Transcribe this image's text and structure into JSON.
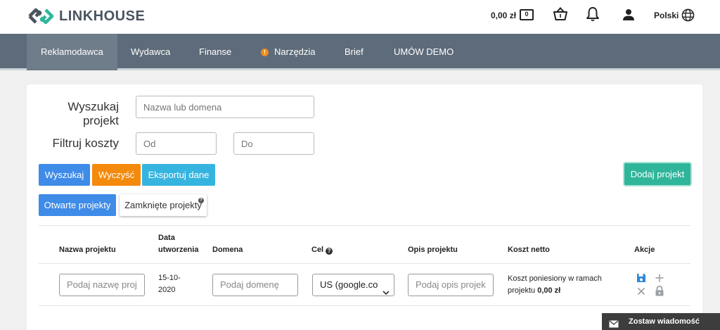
{
  "header": {
    "logo_text": "LINKHOUSE",
    "balance": "0,00 zł",
    "cash_icon_text": "0",
    "language": "Polski",
    "icons": [
      "logo-icon",
      "cash-icon",
      "basket-icon",
      "bell-icon",
      "user-icon",
      "globe-icon"
    ]
  },
  "nav": {
    "items": [
      {
        "label": "Reklamodawca",
        "active": true
      },
      {
        "label": "Wydawca",
        "active": false
      },
      {
        "label": "Finanse",
        "active": false
      },
      {
        "label": "Narzędzia",
        "active": false,
        "badge": "!"
      },
      {
        "label": "Brief",
        "active": false
      },
      {
        "label": "UMÓW DEMO",
        "active": false
      }
    ]
  },
  "filters": {
    "search_label": "Wyszukaj projekt",
    "search_placeholder": "Nazwa lub domena",
    "cost_label": "Filtruj koszty",
    "from_placeholder": "Od",
    "to_placeholder": "Do"
  },
  "actions": {
    "search": "Wyszukaj",
    "clear": "Wyczyść",
    "export": "Eksportuj dane",
    "add_project": "Dodaj projekt"
  },
  "tabs": {
    "open": "Otwarte projekty",
    "closed": "Zamknięte projekty",
    "closed_help": "?"
  },
  "table": {
    "headers": {
      "name": "Nazwa projektu",
      "date": "Data utworzenia",
      "domain": "Domena",
      "goal": "Cel",
      "description": "Opis projektu",
      "cost": "Koszt netto",
      "actions": "Akcje"
    },
    "row": {
      "name_placeholder": "Podaj nazwę proj",
      "date": "15-10-2020",
      "domain_placeholder": "Podaj domenę",
      "goal_selected": "US (google.co",
      "description_placeholder": "Podaj opis projek",
      "cost_text": "Koszt poniesiony w ramach projektu",
      "cost_value": "0,00 zł"
    }
  },
  "footer": {
    "leave_message": "Zostaw wiadomość"
  },
  "colors": {
    "nav_bg": "#5d6b7a",
    "blue": "#3e8be8",
    "orange": "#f48a0c",
    "cyan": "#36b4e0",
    "green": "#2fb59a"
  }
}
